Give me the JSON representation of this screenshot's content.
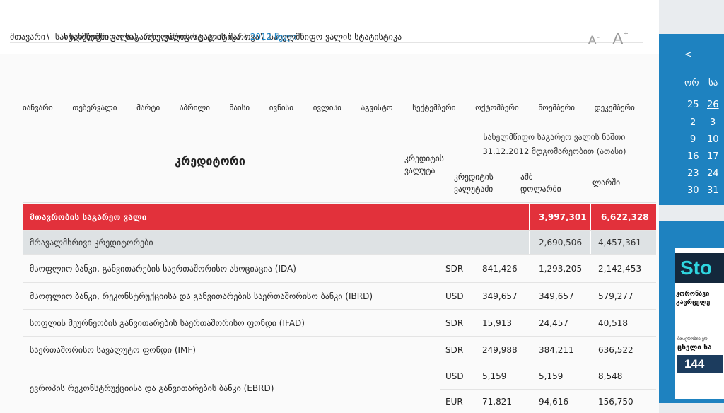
{
  "breadcrumb": {
    "items": [
      "მთავარი",
      "სახელმწიფო ვალი",
      "სახელმწიფო ვალის მართვა",
      "სახელმწიფო ვალის სტატისტიკა",
      "სახელმწიფო საგარეო ვალის სტატისტიკა"
    ],
    "separator": "\\",
    "current": "2012 წელი"
  },
  "font_controls": {
    "decrease": "A",
    "decrease_sign": "-",
    "increase": "A",
    "increase_sign": "+"
  },
  "months": [
    "იანვარი",
    "თებერვალი",
    "მარტი",
    "აპრილი",
    "მაისი",
    "ივნისი",
    "ივლისი",
    "აგვისტო",
    "სექტემბერი",
    "ოქტომბერი",
    "ნოემბერი",
    "დეკემბერი"
  ],
  "table": {
    "header": {
      "creditor": "კრედიტორი",
      "currency_line1": "კრედიტის",
      "currency_line2": "ვალუტა",
      "debt_line1": "სახელმწიფო საგარეო ვალის ნაშთი",
      "debt_line2": "31.12.2012 მდგომარეობით (ათასი)",
      "sub1_line1": "კრედიტის",
      "sub1_line2": "ვალუტაში",
      "sub2_line1": "აშშ",
      "sub2_line2": "დოლარში",
      "sub3": "ლარში"
    },
    "total": {
      "name": "მთავრობის საგარეო ვალი",
      "usd": "3,997,301",
      "gel": "6,622,328"
    },
    "multilateral": {
      "name": "მრავალმხრივი კრედიტორები",
      "usd": "2,690,506",
      "gel": "4,457,361"
    },
    "rows": [
      {
        "name": "მსოფლიო ბანკი, განვითარების საერთაშორისო ასოციაცია (IDA)",
        "currency": "SDR",
        "orig": "841,426",
        "usd": "1,293,205",
        "gel": "2,142,453"
      },
      {
        "name": "მსოფლიო ბანკი, რეკონსტრუქციისა და განვითარების საერთაშორისო ბანკი (IBRD)",
        "currency": "USD",
        "orig": "349,657",
        "usd": "349,657",
        "gel": "579,277"
      },
      {
        "name": "სოფლის მეურნეობის განვითარების საერთაშორისო ფონდი (IFAD)",
        "currency": "SDR",
        "orig": "15,913",
        "usd": "24,457",
        "gel": "40,518"
      },
      {
        "name": "საერთაშორისო სავალუტო ფონდი (IMF)",
        "currency": "SDR",
        "orig": "249,988",
        "usd": "384,211",
        "gel": "636,522"
      }
    ],
    "ebrd": {
      "name": "ევროპის რეკონსტრუქციისა და განვითარების ბანკი (EBRD)",
      "lines": [
        {
          "currency": "USD",
          "orig": "5,159",
          "usd": "5,159",
          "gel": "8,548"
        },
        {
          "currency": "EUR",
          "orig": "71,821",
          "usd": "94,616",
          "gel": "156,750"
        }
      ]
    }
  },
  "calendar": {
    "prev": "<",
    "day_headers": [
      "ორ",
      "სა"
    ],
    "days": [
      [
        "25",
        "26"
      ],
      [
        "2",
        "3"
      ],
      [
        "9",
        "10"
      ],
      [
        "16",
        "17"
      ],
      [
        "23",
        "24"
      ],
      [
        "30",
        "31"
      ]
    ],
    "highlighted": "26"
  },
  "ad": {
    "brand": "Sto",
    "text1_line1": "კორონავი",
    "text1_line2": "გავრცელე",
    "text2": "მთავრობის ერ",
    "text3": "ცხელი ხა",
    "number": "144"
  },
  "colors": {
    "accent_red": "#e2313b",
    "accent_blue": "#1e82c0",
    "link_blue": "#1b84c6",
    "gray_row": "#dee2e4"
  }
}
